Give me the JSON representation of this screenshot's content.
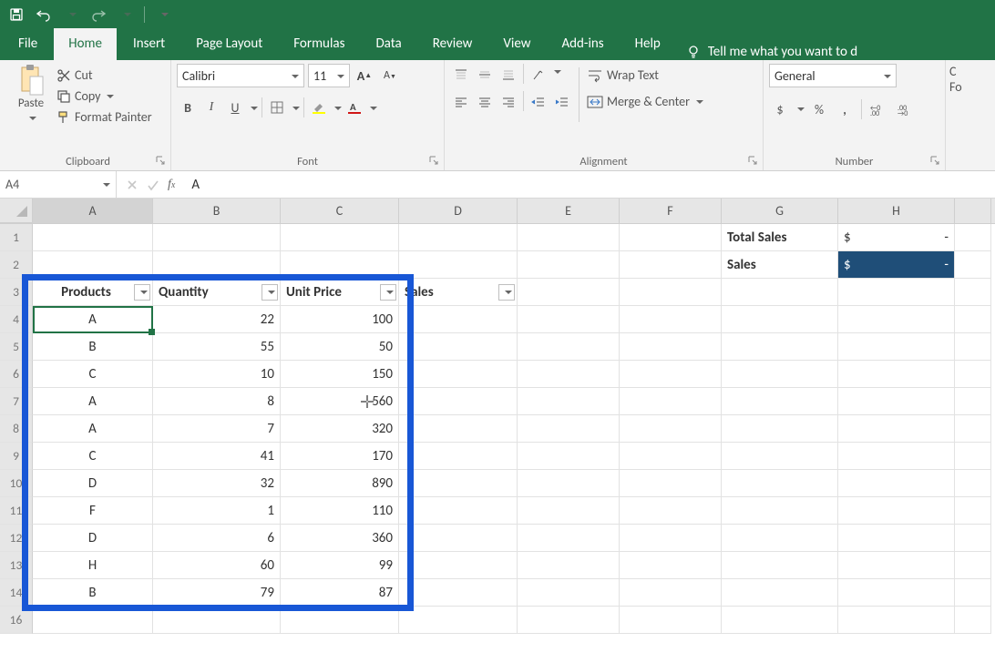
{
  "menubar": {
    "tabs": [
      "File",
      "Home",
      "Insert",
      "Page Layout",
      "Formulas",
      "Data",
      "Review",
      "View",
      "Add-ins",
      "Help"
    ],
    "active": "Home",
    "tellme": "Tell me what you want to d"
  },
  "ribbon": {
    "clipboard": {
      "paste": "Paste",
      "cut": "Cut",
      "copy": "Copy",
      "format_painter": "Format Painter",
      "label": "Clipboard"
    },
    "font": {
      "name": "Calibri",
      "size": "11",
      "bold": "B",
      "italic": "I",
      "underline": "U",
      "label": "Font"
    },
    "alignment": {
      "wrap": "Wrap Text",
      "merge": "Merge & Center",
      "label": "Alignment"
    },
    "number": {
      "format": "General",
      "currency": "$",
      "percent": "%",
      "comma": ",",
      "label": "Number"
    },
    "cells_hint": "C\nFo"
  },
  "formula_bar": {
    "cell_ref": "A4",
    "formula": "A"
  },
  "columns": [
    "A",
    "B",
    "C",
    "D",
    "E",
    "F",
    "G",
    "H"
  ],
  "g1": "Total Sales",
  "g2": "Sales",
  "h1_currency": "$",
  "h1_value": "-",
  "h2_currency": "$",
  "h2_value": "-",
  "table": {
    "headers": {
      "a": "Products",
      "b": "Quantity",
      "c": "Unit Price",
      "d": "Sales"
    },
    "rows": [
      {
        "p": "A",
        "q": "22",
        "u": "100"
      },
      {
        "p": "B",
        "q": "55",
        "u": "50"
      },
      {
        "p": "C",
        "q": "10",
        "u": "150"
      },
      {
        "p": "A",
        "q": "8",
        "u": "560"
      },
      {
        "p": "A",
        "q": "7",
        "u": "320"
      },
      {
        "p": "C",
        "q": "41",
        "u": "170"
      },
      {
        "p": "D",
        "q": "32",
        "u": "890"
      },
      {
        "p": "F",
        "q": "1",
        "u": "110"
      },
      {
        "p": "D",
        "q": "6",
        "u": "360"
      },
      {
        "p": "H",
        "q": "60",
        "u": "99"
      },
      {
        "p": "B",
        "q": "79",
        "u": "87"
      }
    ]
  },
  "row16_label": "16"
}
